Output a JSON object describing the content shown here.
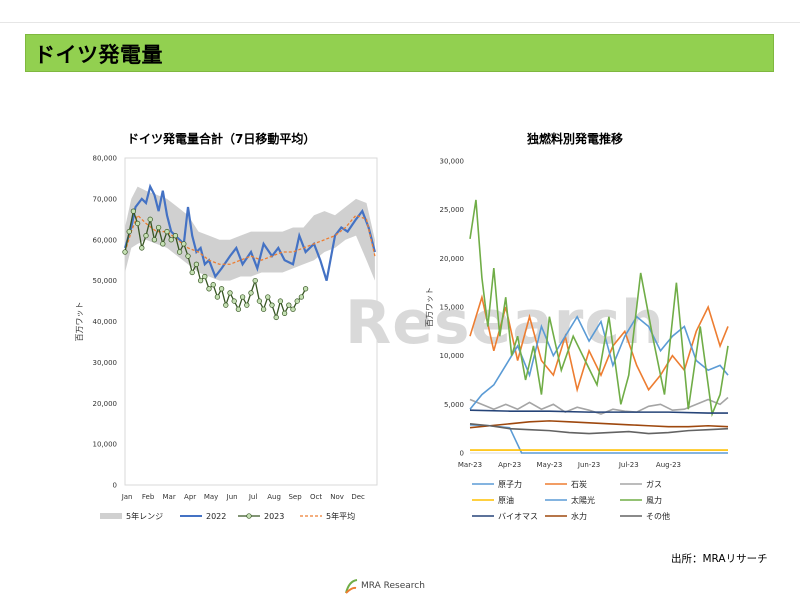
{
  "header": {
    "title": "ドイツ発電量"
  },
  "footer": {
    "source": "出所：MRAリサーチ",
    "logo_text": "MRA Research"
  },
  "watermark": {
    "text": "Research"
  },
  "colors": {
    "header_bg": "#92d050",
    "range": "#d0d0d0",
    "y2022": "#4472c4",
    "y2023_line": "#375623",
    "y2023_marker": "#c5e0b4",
    "avg5": "#ed7d31",
    "nuclear": "#5b9bd5",
    "coal": "#ed7d31",
    "gas": "#a5a5a5",
    "oil": "#ffc000",
    "solar": "#5b9bd5",
    "wind": "#70ad47",
    "biomass": "#264478",
    "hydro": "#9e480e",
    "other": "#636363"
  },
  "chart_data": [
    {
      "type": "line",
      "title": "ドイツ発電量合計（7日移動平均）",
      "ylabel": "百万ワット",
      "ylim": [
        0,
        80000
      ],
      "yticks": [
        "0",
        "10,000",
        "20,000",
        "30,000",
        "40,000",
        "50,000",
        "60,000",
        "70,000",
        "80,000"
      ],
      "x_labels": [
        "Jan",
        "Feb",
        "Mar",
        "Apr",
        "May",
        "Jun",
        "Jul",
        "Aug",
        "Sep",
        "Oct",
        "Nov",
        "Dec"
      ],
      "x_unit": "month index (0 = Jan 1, 12 = Dec 31)",
      "grid": false,
      "legend_position": "bottom",
      "legend": [
        "5年レンジ",
        "2022",
        "2023",
        "5年平均"
      ],
      "range_5yr": {
        "x": [
          0,
          0.3,
          0.6,
          1.0,
          1.5,
          2.0,
          2.5,
          3.0,
          3.5,
          4.0,
          4.5,
          5.0,
          5.5,
          6.0,
          6.5,
          7.0,
          7.5,
          8.0,
          8.5,
          9.0,
          9.5,
          10.0,
          10.5,
          11.0,
          11.5,
          11.9
        ],
        "low": [
          52000,
          58000,
          59000,
          60000,
          59000,
          58000,
          56000,
          54000,
          52000,
          51000,
          50000,
          50000,
          51000,
          51000,
          52000,
          52000,
          52000,
          53000,
          54000,
          55000,
          57000,
          58000,
          60000,
          61000,
          55000,
          50000
        ],
        "high": [
          63000,
          70000,
          73000,
          72000,
          71000,
          70000,
          68000,
          66000,
          62000,
          61000,
          60000,
          60000,
          61000,
          62000,
          62000,
          62000,
          62000,
          63000,
          63000,
          66000,
          67000,
          66000,
          68000,
          70000,
          69000,
          60000
        ]
      },
      "series": [
        {
          "name": "2022",
          "x": [
            0,
            0.3,
            0.5,
            0.8,
            1.0,
            1.2,
            1.4,
            1.6,
            1.8,
            2.0,
            2.2,
            2.4,
            2.6,
            2.8,
            3.0,
            3.2,
            3.4,
            3.6,
            3.8,
            4.0,
            4.3,
            4.6,
            5.0,
            5.3,
            5.6,
            6.0,
            6.3,
            6.6,
            7.0,
            7.3,
            7.6,
            8.0,
            8.3,
            8.6,
            9.0,
            9.3,
            9.6,
            10.0,
            10.3,
            10.6,
            11.0,
            11.3,
            11.6,
            11.9
          ],
          "values": [
            58000,
            63000,
            68000,
            70000,
            69000,
            73000,
            71000,
            67000,
            72000,
            66000,
            62000,
            61000,
            60000,
            59000,
            68000,
            61000,
            57000,
            58000,
            54000,
            55000,
            51000,
            53000,
            56000,
            58000,
            54000,
            57000,
            53000,
            59000,
            56000,
            58000,
            55000,
            54000,
            61000,
            57000,
            59000,
            55000,
            50000,
            61000,
            63000,
            62000,
            65000,
            67000,
            63000,
            57000
          ]
        },
        {
          "name": "2023",
          "x": [
            0,
            0.2,
            0.4,
            0.6,
            0.8,
            1.0,
            1.2,
            1.4,
            1.6,
            1.8,
            2.0,
            2.2,
            2.4,
            2.6,
            2.8,
            3.0,
            3.2,
            3.4,
            3.6,
            3.8,
            4.0,
            4.2,
            4.4,
            4.6,
            4.8,
            5.0,
            5.2,
            5.4,
            5.6,
            5.8,
            6.0,
            6.2,
            6.4,
            6.6,
            6.8,
            7.0,
            7.2,
            7.4,
            7.6,
            7.8,
            8.0,
            8.2,
            8.4,
            8.6
          ],
          "values": [
            57000,
            62000,
            67000,
            64000,
            58000,
            61000,
            65000,
            60000,
            63000,
            59000,
            62000,
            60000,
            61000,
            57000,
            59000,
            56000,
            52000,
            54000,
            50000,
            51000,
            48000,
            49000,
            46000,
            48000,
            44000,
            47000,
            45000,
            43000,
            46000,
            44000,
            47000,
            50000,
            45000,
            43000,
            46000,
            44000,
            41000,
            45000,
            42000,
            44000,
            43000,
            45000,
            46000,
            48000
          ]
        },
        {
          "name": "5年平均",
          "x": [
            0,
            0.3,
            0.6,
            1.0,
            1.5,
            2.0,
            2.5,
            3.0,
            3.5,
            4.0,
            4.5,
            5.0,
            5.5,
            6.0,
            6.5,
            7.0,
            7.5,
            8.0,
            8.5,
            9.0,
            9.5,
            10.0,
            10.5,
            11.0,
            11.5,
            11.9
          ],
          "values": [
            57000,
            62000,
            66000,
            64000,
            62000,
            62000,
            60000,
            58000,
            57000,
            55000,
            54000,
            54000,
            55000,
            56000,
            55000,
            56000,
            57000,
            57000,
            58000,
            59000,
            60000,
            61000,
            63000,
            66000,
            65000,
            56000
          ]
        }
      ]
    },
    {
      "type": "line",
      "title": "独燃料別発電推移",
      "ylabel": "百万ワット",
      "ylim": [
        0,
        30000
      ],
      "yticks": [
        "0",
        "5,000",
        "10,000",
        "15,000",
        "20,000",
        "25,000",
        "30,000"
      ],
      "x_labels": [
        "Mar-23",
        "Apr-23",
        "May-23",
        "Jun-23",
        "Jul-23",
        "Aug-23"
      ],
      "x_unit": "month index (0 = Mar-23 start)",
      "grid": false,
      "legend_position": "bottom",
      "series": [
        {
          "name": "原子力",
          "x": [
            0,
            0.5,
            1.0,
            1.3,
            1.5,
            6.5
          ],
          "values": [
            2900,
            2800,
            2600,
            0,
            0,
            0
          ]
        },
        {
          "name": "石炭",
          "x": [
            0,
            0.3,
            0.6,
            0.9,
            1.2,
            1.5,
            1.8,
            2.1,
            2.4,
            2.7,
            3.0,
            3.3,
            3.6,
            3.9,
            4.2,
            4.5,
            4.8,
            5.1,
            5.4,
            5.7,
            6.0,
            6.3,
            6.5
          ],
          "values": [
            12000,
            16000,
            10500,
            15000,
            9500,
            14000,
            9500,
            8000,
            12000,
            6500,
            10500,
            8000,
            11000,
            12500,
            9000,
            6500,
            8000,
            10000,
            8500,
            12500,
            15000,
            11000,
            13000
          ]
        },
        {
          "name": "ガス",
          "x": [
            0,
            0.3,
            0.6,
            0.9,
            1.2,
            1.5,
            1.8,
            2.1,
            2.4,
            2.7,
            3.0,
            3.3,
            3.6,
            3.9,
            4.2,
            4.5,
            4.8,
            5.1,
            5.4,
            5.7,
            6.0,
            6.3,
            6.5
          ],
          "values": [
            5500,
            5000,
            4500,
            5000,
            4500,
            5200,
            4500,
            5000,
            4200,
            4700,
            4400,
            4000,
            4500,
            4300,
            4200,
            4800,
            5000,
            4400,
            4500,
            5000,
            5500,
            5000,
            5700
          ]
        },
        {
          "name": "原油",
          "x": [
            0,
            1.0,
            2.0,
            3.0,
            4.0,
            5.0,
            6.0,
            6.5
          ],
          "values": [
            300,
            300,
            300,
            300,
            300,
            300,
            300,
            300
          ]
        },
        {
          "name": "太陽光",
          "x": [
            0,
            0.3,
            0.6,
            0.9,
            1.2,
            1.5,
            1.8,
            2.1,
            2.4,
            2.7,
            3.0,
            3.3,
            3.6,
            3.9,
            4.2,
            4.5,
            4.8,
            5.1,
            5.4,
            5.7,
            6.0,
            6.3,
            6.5
          ],
          "values": [
            4500,
            6000,
            7000,
            9000,
            11000,
            8000,
            13000,
            10000,
            12000,
            14000,
            11500,
            13500,
            9000,
            12000,
            14000,
            13000,
            10500,
            12000,
            13000,
            9500,
            8500,
            9000,
            8000
          ]
        },
        {
          "name": "風力",
          "x": [
            0,
            0.15,
            0.3,
            0.45,
            0.6,
            0.75,
            0.9,
            1.05,
            1.2,
            1.4,
            1.6,
            1.8,
            2.0,
            2.3,
            2.6,
            2.9,
            3.2,
            3.5,
            3.8,
            4.0,
            4.3,
            4.6,
            4.9,
            5.2,
            5.5,
            5.8,
            6.1,
            6.3,
            6.5
          ],
          "values": [
            22000,
            26000,
            18000,
            13000,
            19000,
            12000,
            16000,
            10000,
            12000,
            7500,
            11000,
            6000,
            14000,
            8500,
            12000,
            9500,
            7000,
            14000,
            5000,
            8000,
            18500,
            12000,
            6000,
            17500,
            4500,
            13000,
            4000,
            6000,
            11000
          ]
        },
        {
          "name": "バイオマス",
          "x": [
            0,
            1.0,
            2.0,
            3.0,
            4.0,
            5.0,
            6.0,
            6.5
          ],
          "values": [
            4400,
            4300,
            4300,
            4200,
            4200,
            4200,
            4100,
            4100
          ]
        },
        {
          "name": "水力",
          "x": [
            0,
            0.5,
            1.0,
            1.5,
            2.0,
            2.5,
            3.0,
            3.5,
            4.0,
            4.5,
            5.0,
            5.5,
            6.0,
            6.5
          ],
          "values": [
            2600,
            2800,
            3000,
            3200,
            3300,
            3200,
            3100,
            3000,
            2900,
            2800,
            2700,
            2700,
            2800,
            2700
          ]
        },
        {
          "name": "その他",
          "x": [
            0,
            0.5,
            1.0,
            1.5,
            2.0,
            2.5,
            3.0,
            3.5,
            4.0,
            4.5,
            5.0,
            5.5,
            6.0,
            6.5
          ],
          "values": [
            3000,
            2800,
            2500,
            2400,
            2300,
            2100,
            2000,
            2100,
            2200,
            2000,
            2100,
            2300,
            2400,
            2500
          ]
        }
      ]
    }
  ]
}
